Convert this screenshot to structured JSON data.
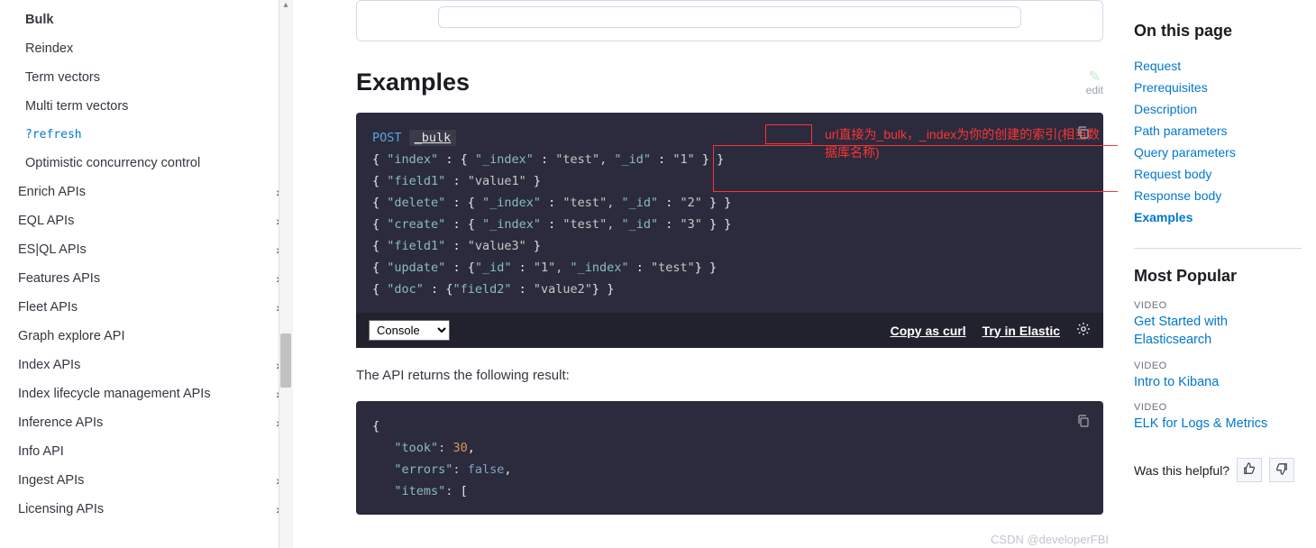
{
  "sidebar": {
    "items": [
      {
        "label": "Bulk",
        "bold": true,
        "sub": true
      },
      {
        "label": "Reindex",
        "sub": true
      },
      {
        "label": "Term vectors",
        "sub": true
      },
      {
        "label": "Multi term vectors",
        "sub": true
      },
      {
        "label": "?refresh",
        "sub": true,
        "mono": true
      },
      {
        "label": "Optimistic concurrency control",
        "sub": true
      },
      {
        "label": "Enrich APIs",
        "chev": true
      },
      {
        "label": "EQL APIs",
        "chev": true
      },
      {
        "label": "ES|QL APIs",
        "chev": true
      },
      {
        "label": "Features APIs",
        "chev": true
      },
      {
        "label": "Fleet APIs",
        "chev": true
      },
      {
        "label": "Graph explore API"
      },
      {
        "label": "Index APIs",
        "chev": true
      },
      {
        "label": "Index lifecycle management APIs",
        "chev": true
      },
      {
        "label": "Inference APIs",
        "chev": true
      },
      {
        "label": "Info API"
      },
      {
        "label": "Ingest APIs",
        "chev": true
      },
      {
        "label": "Licensing APIs",
        "chev": true
      }
    ]
  },
  "main": {
    "heading": "Examples",
    "edit_label": "edit",
    "annotation": "url直接为_bulk，_index为你的创建的索引(相当数据库名称)",
    "code1": {
      "method": "POST",
      "path": "_bulk",
      "lines_raw": "{ \"index\" : { \"_index\" : \"test\", \"_id\" : \"1\" } }\n{ \"field1\" : \"value1\" }\n{ \"delete\" : { \"_index\" : \"test\", \"_id\" : \"2\" } }\n{ \"create\" : { \"_index\" : \"test\", \"_id\" : \"3\" } }\n{ \"field1\" : \"value3\" }\n{ \"update\" : {\"_id\" : \"1\", \"_index\" : \"test\"} }\n{ \"doc\" : {\"field2\" : \"value2\"} }"
    },
    "toolbar": {
      "select_value": "Console",
      "copy_curl": "Copy as curl",
      "try_elastic": "Try in Elastic"
    },
    "result_intro": "The API returns the following result:",
    "code2_raw": "{\n   \"took\": 30,\n   \"errors\": false,\n   \"items\": ["
  },
  "right": {
    "toc_title": "On this page",
    "toc": [
      {
        "label": "Request"
      },
      {
        "label": "Prerequisites"
      },
      {
        "label": "Description"
      },
      {
        "label": "Path parameters"
      },
      {
        "label": "Query parameters"
      },
      {
        "label": "Request body"
      },
      {
        "label": "Response body"
      },
      {
        "label": "Examples",
        "active": true
      }
    ],
    "popular_title": "Most Popular",
    "video_label": "VIDEO",
    "popular": [
      "Get Started with Elasticsearch",
      "Intro to Kibana",
      "ELK for Logs & Metrics"
    ],
    "feedback_q": "Was this helpful?"
  },
  "watermark": "CSDN @developerFBI"
}
